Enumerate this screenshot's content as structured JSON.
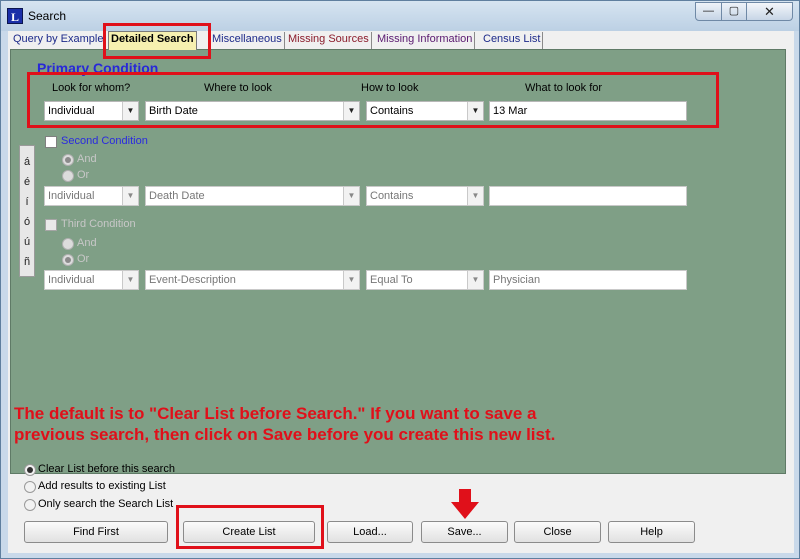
{
  "window": {
    "title": "Search",
    "app_icon_letter": "L",
    "minimize": "—",
    "maximize": "▢",
    "close": "✕"
  },
  "tabs": [
    {
      "label": "Query by Example"
    },
    {
      "label": "Detailed Search"
    },
    {
      "label": "Miscellaneous"
    },
    {
      "label": "Missing Sources"
    },
    {
      "label": "Missing Information"
    },
    {
      "label": "Census List"
    }
  ],
  "primary": {
    "title": "Primary Condition",
    "headers": {
      "whom": "Look for whom?",
      "where": "Where to look",
      "how": "How to look",
      "what": "What to look for"
    },
    "whom": "Individual",
    "where": "Birth Date",
    "how": "Contains",
    "what": "13 Mar"
  },
  "accent_chars": [
    "á",
    "é",
    "í",
    "ó",
    "ú",
    "ñ"
  ],
  "second": {
    "label": "Second Condition",
    "and": "And",
    "or": "Or",
    "whom": "Individual",
    "where": "Death Date",
    "how": "Contains",
    "what": ""
  },
  "third": {
    "label": "Third Condition",
    "and": "And",
    "or": "Or",
    "whom": "Individual",
    "where": "Event-Description",
    "how": "Equal To",
    "what": "Physician"
  },
  "annotation": {
    "line1": "The default is to \"Clear List before Search.\"  If you want to save a",
    "line2": "previous search, then click on Save before you create this new list.",
    "color": "#e0101a"
  },
  "options": [
    {
      "label": "Clear List before this search",
      "selected": true
    },
    {
      "label": "Add results to existing List",
      "selected": false
    },
    {
      "label": "Only search the Search List",
      "selected": false
    }
  ],
  "buttons": {
    "find_first": "Find First",
    "create_list": "Create List",
    "load": "Load...",
    "save": "Save...",
    "close": "Close",
    "help": "Help"
  }
}
